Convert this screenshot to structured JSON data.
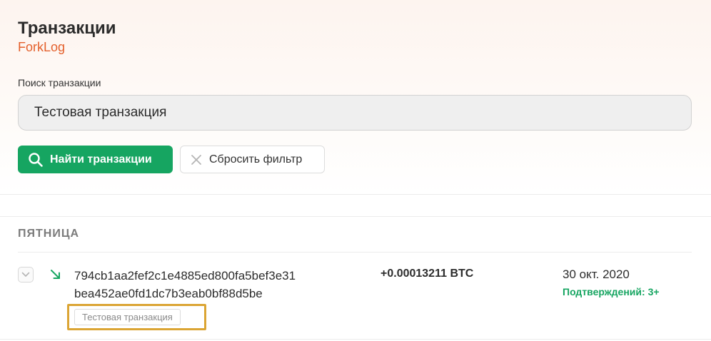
{
  "header": {
    "title": "Транзакции",
    "subtitle": "ForkLog"
  },
  "search": {
    "label": "Поиск транзакции",
    "value": "Тестовая транзакция",
    "placeholder": ""
  },
  "actions": {
    "find_label": "Найти транзакции",
    "reset_label": "Сбросить фильтр"
  },
  "colors": {
    "accent": "#16a561",
    "brand": "#e4602c",
    "highlight": "#dba534"
  },
  "groups": [
    {
      "heading": "ПЯТНИЦА",
      "transactions": [
        {
          "direction_icon": "incoming-arrow-icon",
          "hash_line1": "794cb1aa2fef2c1e4885ed800fa5bef3e31",
          "hash_line2": "bea452ae0fd1dc7b3eab0bf88d5be",
          "amount": "+0.00013211 BTC",
          "date": "30 окт. 2020",
          "confirmations": "Подтверждений: 3+",
          "tag": "Тестовая транзакция"
        }
      ]
    }
  ]
}
